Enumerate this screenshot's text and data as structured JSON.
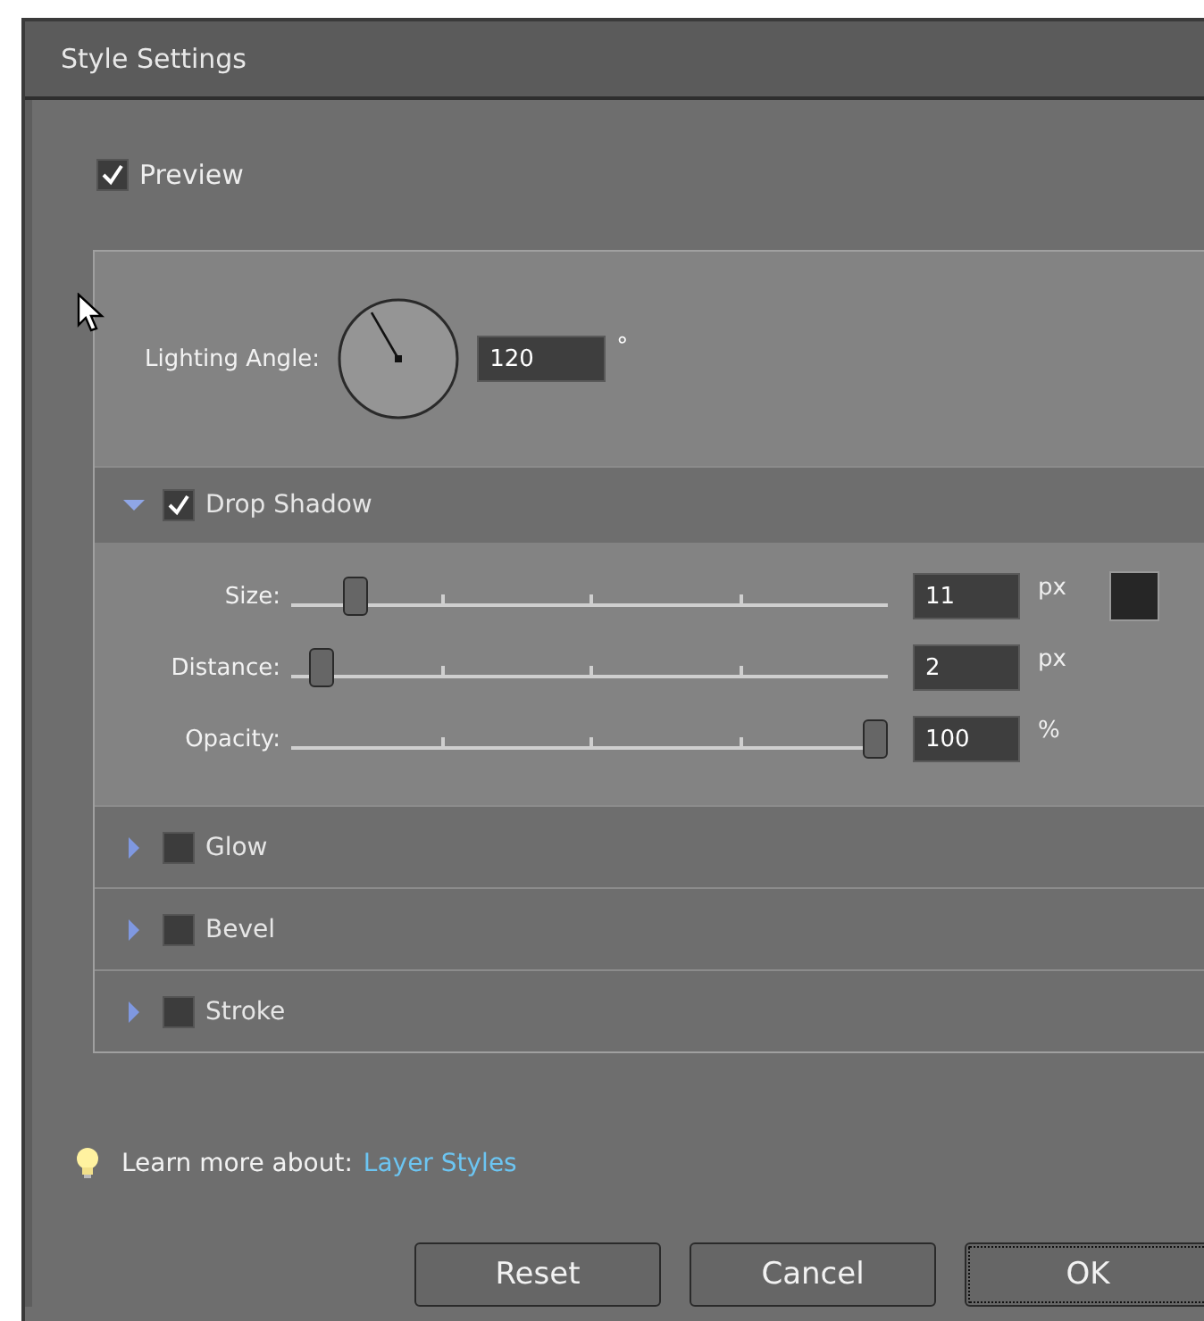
{
  "window": {
    "title": "Style Settings"
  },
  "preview": {
    "label": "Preview",
    "checked": true
  },
  "lighting_angle": {
    "label": "Lighting Angle:",
    "value": "120",
    "unit": "°"
  },
  "effects": [
    {
      "label": "Drop Shadow",
      "expanded": true,
      "checked": true,
      "controls": [
        {
          "label": "Size:",
          "level": 0.09,
          "value": "11",
          "unit": "px"
        },
        {
          "label": "Distance:",
          "level": 0.03,
          "value": "2",
          "unit": "px"
        },
        {
          "label": "Opacity:",
          "level": 1,
          "value": "100",
          "unit": "%"
        }
      ]
    },
    {
      "label": "Glow",
      "expanded": false,
      "checked": false
    },
    {
      "label": "Bevel",
      "expanded": false,
      "checked": false
    },
    {
      "label": "Stroke",
      "expanded": false,
      "checked": false
    }
  ],
  "learn_more": {
    "text": "Learn more about:",
    "link": "Layer Styles"
  },
  "buttons": [
    {
      "label": "Reset",
      "default": false
    },
    {
      "label": "Cancel",
      "default": false
    },
    {
      "label": "OK",
      "default": true
    }
  ]
}
